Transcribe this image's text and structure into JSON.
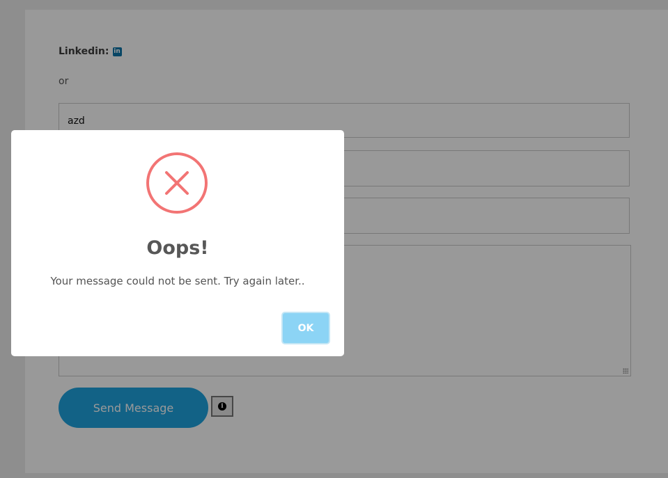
{
  "contact": {
    "linkedin_label": "Linkedin:",
    "linkedin_icon": "linkedin-icon",
    "linkedin_icon_glyph": "in",
    "or_text": "or",
    "field1_value": "azd",
    "send_label": "Send Message",
    "info_icon": "info-icon",
    "info_glyph": "i"
  },
  "modal": {
    "icon": "error-x-icon",
    "title": "Oops!",
    "message": "Your message could not be sent. Try again later..",
    "ok_label": "OK"
  },
  "colors": {
    "error": "#f27474",
    "ok_button": "#8cd4f5",
    "send_button": "#1fa3e0",
    "linkedin": "#0e76a8"
  }
}
